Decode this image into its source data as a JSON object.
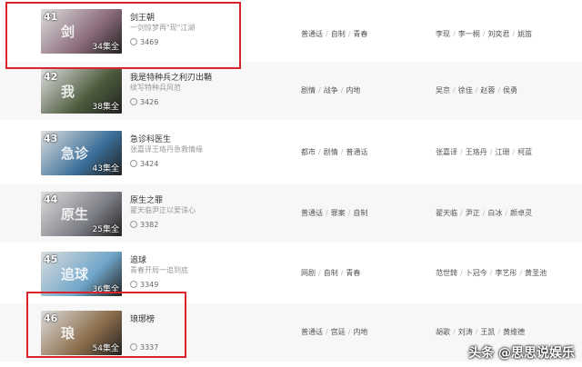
{
  "items": [
    {
      "rank": "41",
      "title": "剑王朝",
      "desc": "一剑惊梦再\"现\"江湖",
      "episodes": "34集全",
      "plays": "3469",
      "tags": [
        "普通话",
        "自制",
        "青春"
      ],
      "cast": [
        "李现",
        "李一桐",
        "刘奕君",
        "姚笛"
      ],
      "poster_text": "剑",
      "color": "#8a6a7a"
    },
    {
      "rank": "42",
      "title": "我是特种兵之利刃出鞘",
      "desc": "续写特种兵风范",
      "episodes": "38集全",
      "plays": "3426",
      "tags": [
        "剧情",
        "战争",
        "内地"
      ],
      "cast": [
        "吴京",
        "徐佳",
        "赵蓉",
        "侯勇"
      ],
      "poster_text": "我",
      "color": "#4b5a3c"
    },
    {
      "rank": "43",
      "title": "急诊科医生",
      "desc": "张嘉译王珞丹急救情缘",
      "episodes": "43集全",
      "plays": "3424",
      "tags": [
        "都市",
        "剧情",
        "普通话"
      ],
      "cast": [
        "张嘉译",
        "王珞丹",
        "江珊",
        "柯蓝"
      ],
      "poster_text": "急诊",
      "color": "#3b6f9a"
    },
    {
      "rank": "44",
      "title": "原生之罪",
      "desc": "翟天临尹正以爱诛心",
      "episodes": "25集全",
      "plays": "3382",
      "tags": [
        "普通话",
        "罪案",
        "自制"
      ],
      "cast": [
        "翟天临",
        "尹正",
        "白冰",
        "颜卓灵"
      ],
      "poster_text": "原生",
      "color": "#7d7f86"
    },
    {
      "rank": "45",
      "title": "追球",
      "desc": "青春开局一追到底",
      "episodes": "36集全",
      "plays": "3349",
      "tags": [
        "网剧",
        "自制",
        "青春"
      ],
      "cast": [
        "范世錡",
        "卜冠今",
        "李艺彤",
        "黄圣池"
      ],
      "poster_text": "追球",
      "color": "#6fa6c9"
    },
    {
      "rank": "46",
      "title": "琅琊榜",
      "desc": "",
      "episodes": "54集全",
      "plays": "3337",
      "tags": [
        "普通话",
        "宫廷",
        "内地"
      ],
      "cast": [
        "胡歌",
        "刘涛",
        "王凯",
        "黄维德"
      ],
      "poster_text": "琅",
      "color": "#8a6b4a"
    }
  ],
  "watermark": "头条 @思思说娱乐",
  "highlight_color": "#d9232d"
}
